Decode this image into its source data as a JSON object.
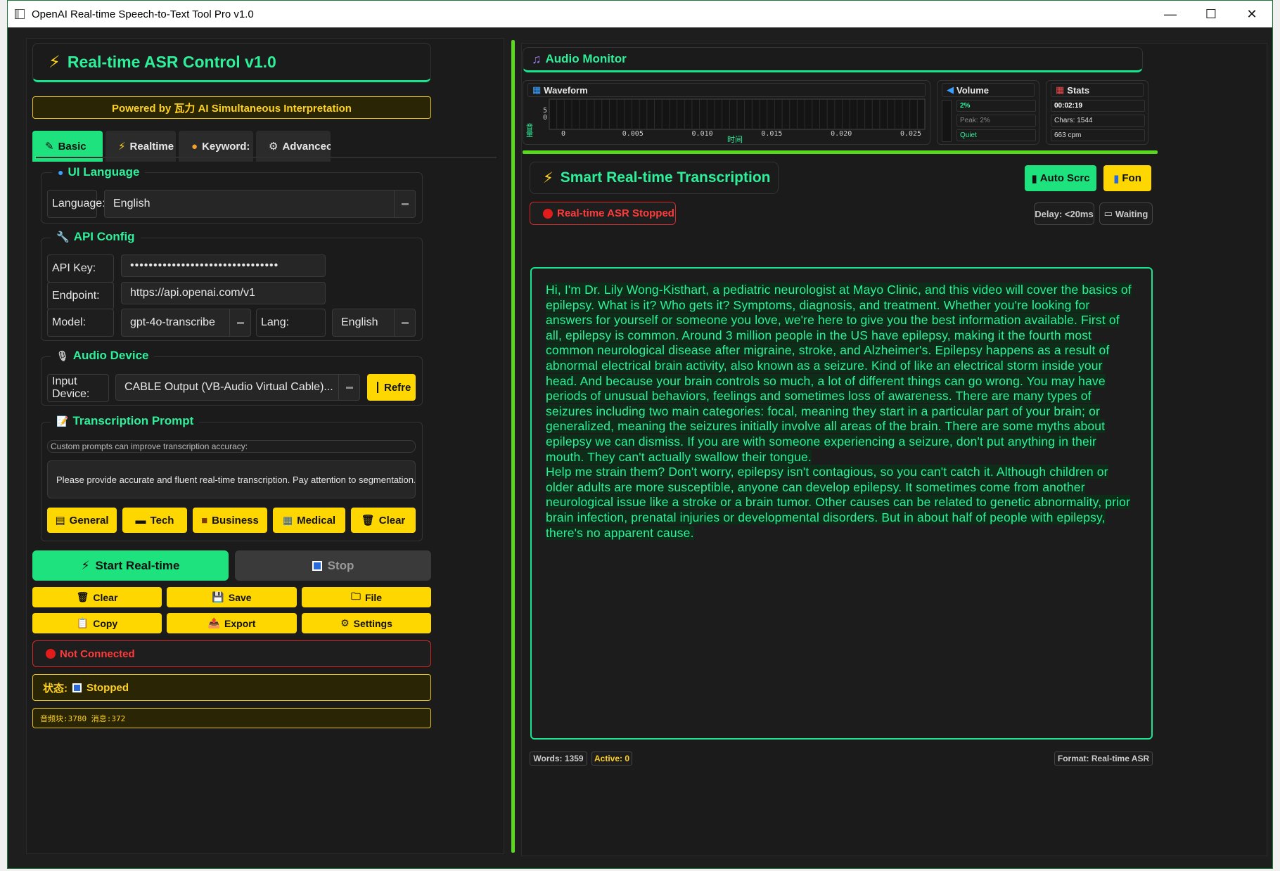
{
  "window": {
    "title": "OpenAI Real-time Speech-to-Text Tool Pro v1.0",
    "minimize": "—",
    "maximize": "☐",
    "close": "✕"
  },
  "left": {
    "header_title": "Real-time ASR Control v1.0",
    "powered_by": "Powered by 瓦力 AI Simultaneous Interpretation",
    "tabs": [
      {
        "label": "Basic",
        "icon": "✎"
      },
      {
        "label": "Realtime",
        "icon": "⚡"
      },
      {
        "label": "Keyword:",
        "icon": "🎨"
      },
      {
        "label": "Advancec",
        "icon": "⚙"
      }
    ],
    "ui_language": {
      "title": "UI Language",
      "label": "Language:",
      "value": "English"
    },
    "api_config": {
      "title": "API Config",
      "api_key_label": "API Key:",
      "api_key_value": "••••••••••••••••••••••••••••••••",
      "endpoint_label": "Endpoint:",
      "endpoint_value": "https://api.openai.com/v1",
      "model_label": "Model:",
      "model_value": "gpt-4o-transcribe",
      "lang_label": "Lang:",
      "lang_value": "English"
    },
    "audio_device": {
      "title": "Audio Device",
      "label": "Input Device:",
      "value": "CABLE Output (VB-Audio Virtual Cable)...",
      "refresh": "Refre"
    },
    "prompt": {
      "title": "Transcription Prompt",
      "hint": "Custom prompts can improve transcription accuracy:",
      "text": "Please provide accurate and fluent real-time transcription. Pay attention to segmentation.",
      "presets": [
        "General",
        "Tech",
        "Business",
        "Medical",
        "Clear"
      ]
    },
    "start": "Start Real-time",
    "stop": "Stop",
    "actions": [
      "Clear",
      "Save",
      "File",
      "Copy",
      "Export",
      "Settings"
    ],
    "connection": "Not Connected",
    "status_label": "状态:",
    "status_value": "Stopped",
    "counters": "音频块:3780 消息:372"
  },
  "right": {
    "monitor_title": "Audio Monitor",
    "waveform": {
      "title": "Waveform",
      "ylabel": "音量",
      "yticks": [
        "5",
        "0"
      ],
      "xticks": [
        "0",
        "0.005",
        "0.010",
        "0.015",
        "0.020",
        "0.025"
      ],
      "xlabel": "时间"
    },
    "volume": {
      "title": "Volume",
      "value": "2%",
      "peak": "Peak: 2%",
      "state": "Quiet"
    },
    "stats": {
      "title": "Stats",
      "time": "00:02:19",
      "chars": "Chars: 1544",
      "cpm": "663 cpm"
    },
    "transcription_title": "Smart Real-time Transcription",
    "auto_scroll": "Auto Scrc",
    "font": "Fon",
    "asr_status": "Real-time ASR Stopped",
    "delay": "Delay: <20ms",
    "waiting": "Waiting",
    "paragraphs": [
      "Hi, I'm Dr. Lily Wong-Kisthart, a pediatric neurologist at Mayo Clinic, and this video will cover the basics of epilepsy. What is it? Who gets it? Symptoms, diagnosis, and treatment. Whether you're looking for answers for yourself or someone you love, we're here to give you the best information available. First of all, epilepsy is common. Around 3 million people in the US have epilepsy, making it the fourth most common neurological disease after migraine, stroke, and Alzheimer's. Epilepsy happens as a result of abnormal electrical brain activity, also known as a seizure. Kind of like an electrical storm inside your head. And because your brain controls so much, a lot of different things can go wrong. You may have periods of unusual behaviors, feelings and sometimes loss of awareness. There are many types of seizures including two main categories: focal, meaning they start in a particular part of your brain; or generalized, meaning the seizures initially involve all areas of the brain. There are some myths about epilepsy we can dismiss. If you are with someone experiencing a seizure, don't put anything in their mouth. They can't actually swallow their tongue.",
      "Help me strain them? Don't worry, epilepsy isn't contagious, so you can't catch it. Although children or older adults are more susceptible, anyone can develop epilepsy. It sometimes come from another neurological issue like a stroke or a brain tumor. Other causes can be related to genetic abnormality, prior brain infection, prenatal injuries or developmental disorders. But in about half of people with epilepsy, there's no apparent cause."
    ],
    "words": "Words: 1359",
    "active": "Active: 0",
    "format": "Format: Real-time ASR"
  },
  "colors": {
    "accent_green": "#1ee27e",
    "text_green": "#2ff09a",
    "yellow": "#ffd700",
    "red": "#e21b1b",
    "background": "#1b1b1b"
  }
}
